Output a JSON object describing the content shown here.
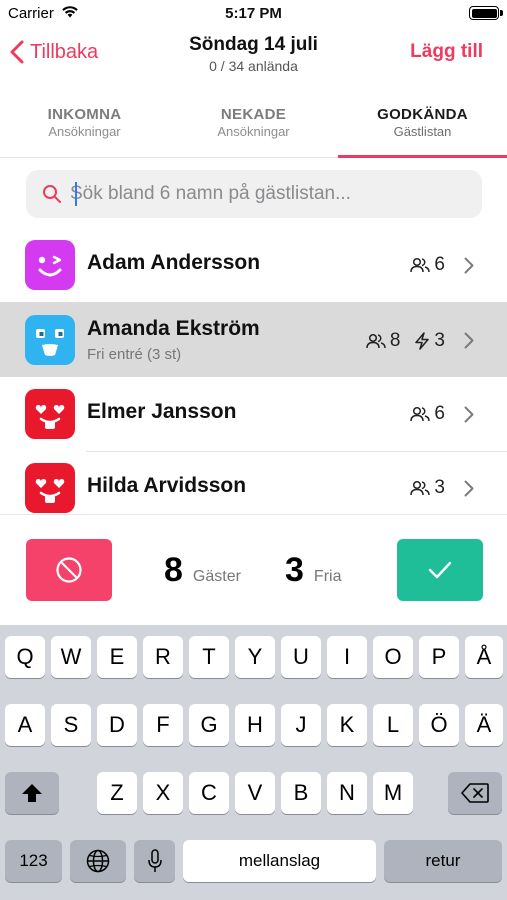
{
  "status_bar": {
    "carrier": "Carrier",
    "time": "5:17 PM"
  },
  "nav": {
    "back_label": "Tillbaka",
    "title": "Söndag 14 juli",
    "subtitle": "0 / 34 anlända",
    "add_label": "Lägg till"
  },
  "tabs": [
    {
      "label": "INKOMNA",
      "sub": "Ansökningar",
      "active": false
    },
    {
      "label": "NEKADE",
      "sub": "Ansökningar",
      "active": false
    },
    {
      "label": "GODKÄNDA",
      "sub": "Gästlistan",
      "active": true
    }
  ],
  "search": {
    "placeholder": "Sök bland 6 namn på gästlistan...",
    "value": ""
  },
  "guests": [
    {
      "name": "Adam Andersson",
      "subtitle": "",
      "guests": "6",
      "free": "",
      "avatar_color": "#d43bf0",
      "avatar": "wink-face-icon",
      "selected": false
    },
    {
      "name": "Amanda Ekström",
      "subtitle": "Fri entré (3 st)",
      "guests": "8",
      "free": "3",
      "avatar_color": "#2fb4f1",
      "avatar": "surprised-face-icon",
      "selected": true
    },
    {
      "name": "Elmer Jansson",
      "subtitle": "",
      "guests": "6",
      "free": "",
      "avatar_color": "#e8182d",
      "avatar": "heart-eyes-face-icon",
      "selected": false
    },
    {
      "name": "Hilda Arvidsson",
      "subtitle": "",
      "guests": "3",
      "free": "",
      "avatar_color": "#e8182d",
      "avatar": "heart-eyes-face-icon",
      "selected": false
    }
  ],
  "action_bar": {
    "guests_count": "8",
    "guests_label": "Gäster",
    "free_count": "3",
    "free_label": "Fria"
  },
  "colors": {
    "accent": "#f0395e",
    "reject": "#f5426a",
    "accept": "#20be98"
  },
  "keyboard": {
    "row1": [
      "Q",
      "W",
      "E",
      "R",
      "T",
      "Y",
      "U",
      "I",
      "O",
      "P",
      "Å"
    ],
    "row2": [
      "A",
      "S",
      "D",
      "F",
      "G",
      "H",
      "J",
      "K",
      "L",
      "Ö",
      "Ä"
    ],
    "row3": [
      "Z",
      "X",
      "C",
      "V",
      "B",
      "N",
      "M"
    ],
    "numbers_label": "123",
    "space_label": "mellanslag",
    "return_label": "retur"
  }
}
